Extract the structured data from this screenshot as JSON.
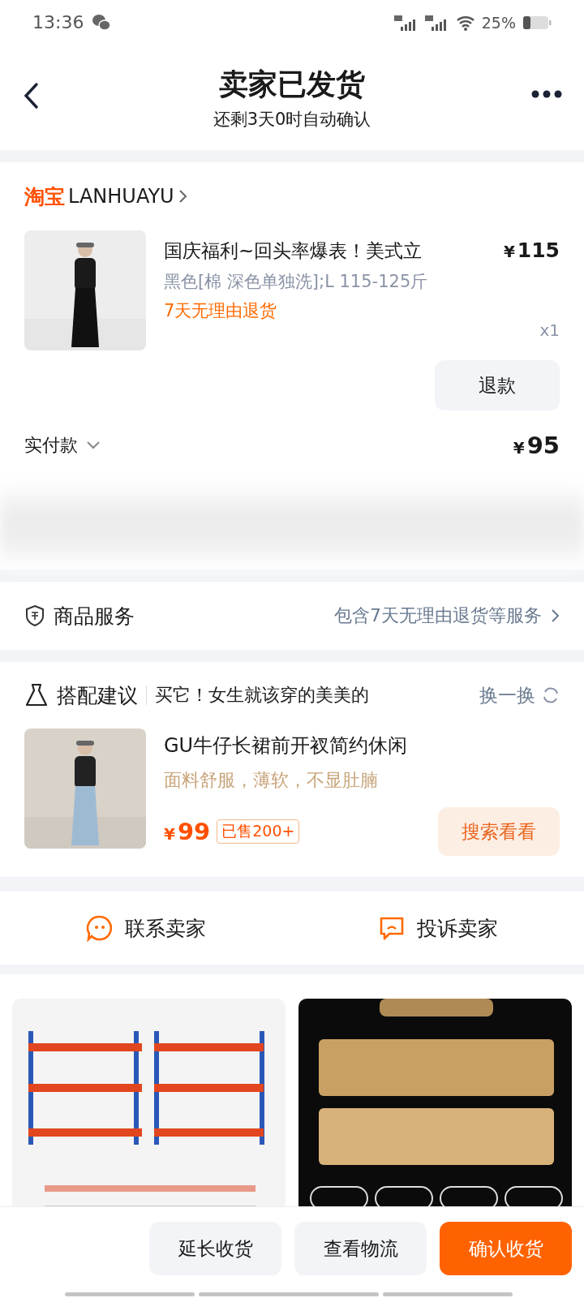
{
  "status_bar": {
    "time": "13:36",
    "battery": "25%"
  },
  "header": {
    "title": "卖家已发货",
    "subtitle": "还剩3天0时自动确认"
  },
  "order": {
    "shop_logo": "淘宝",
    "shop_name": "LANHUAYU",
    "item": {
      "title": "国庆福利~回头率爆表！美式立",
      "spec": "黑色[棉 深色单独洗];L 115-125斤",
      "tag": "7天无理由退货",
      "currency": "¥",
      "price": "115",
      "quantity": "x1"
    },
    "refund_button": "退款",
    "paid": {
      "label": "实付款",
      "currency": "¥",
      "amount": "95"
    }
  },
  "service": {
    "label": "商品服务",
    "detail": "包含7天无理由退货等服务"
  },
  "recommend": {
    "title": "搭配建议",
    "slogan": "买它！女生就该穿的美美的",
    "refresh": "换一换",
    "product": {
      "title": "GU牛仔长裙前开衩简约休闲",
      "desc": "面料舒服，薄软，不显肚腩",
      "currency": "¥",
      "price": "99",
      "sold": "已售200+",
      "button": "搜索看看"
    }
  },
  "actions": [
    {
      "kind": "chat",
      "label": "联系卖家"
    },
    {
      "kind": "complain",
      "label": "投诉卖家"
    }
  ],
  "bottom_buttons": [
    {
      "label": "延长收货",
      "primary": false
    },
    {
      "label": "查看物流",
      "primary": false
    },
    {
      "label": "确认收货",
      "primary": true
    }
  ]
}
